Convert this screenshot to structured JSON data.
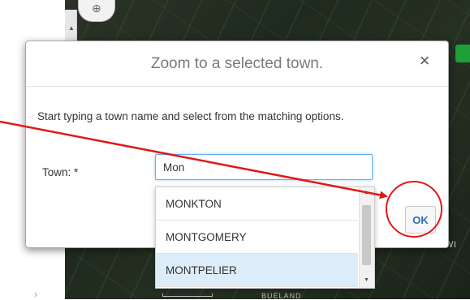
{
  "dialog": {
    "title": "Zoom to a selected town.",
    "close_glyph": "×",
    "instructions": "Start typing a town name and select from the matching options.",
    "town_label": "Town: *",
    "town_input_value": "Mon",
    "ok_label": "OK"
  },
  "dropdown": {
    "options": [
      "MONKTON",
      "MONTGOMERY",
      "MONTPELIER"
    ],
    "selected": "MONTPELIER"
  },
  "map": {
    "label_right": "WI",
    "label_bottom": "BUELAND"
  },
  "colors": {
    "accent": "#2a6ebb",
    "annotation": "#e01818",
    "selected_row": "#dcecf8",
    "badge": "#1d9f39"
  }
}
